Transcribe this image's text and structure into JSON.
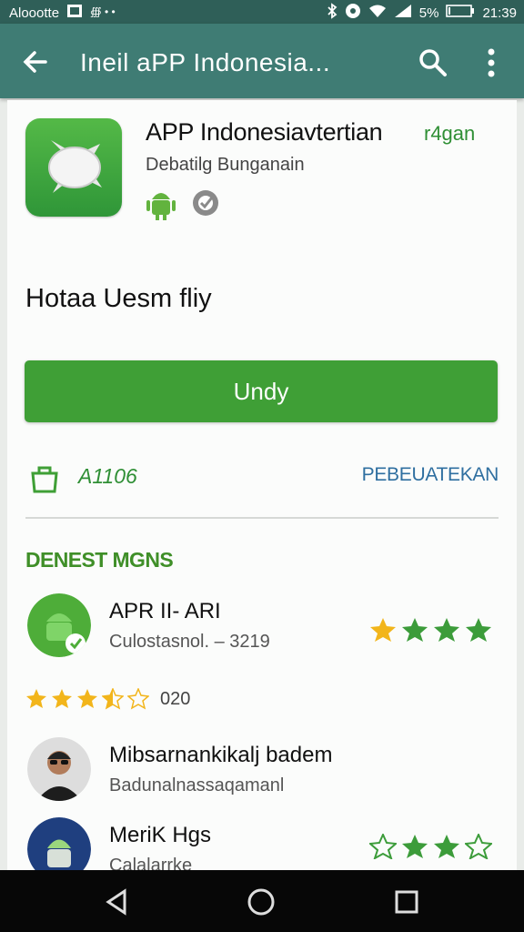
{
  "status_bar": {
    "carrier": "Aloootte",
    "battery_percent": "5%",
    "time": "21:39"
  },
  "app_bar": {
    "title": "Ineil aPP Indonesia..."
  },
  "app": {
    "name": "APP Indonesiavtertian",
    "tag": "r4gan",
    "developer": "Debatilg Bunganain",
    "headline": "Hotaa Uesm fliy",
    "install_label": "Undy",
    "size": "A1106",
    "details_label": "PEBEUATEKAN"
  },
  "reviews_section": {
    "title": "DENEST MGNS",
    "items": [
      {
        "name": "APR II- ARI",
        "subtitle": "Culostasnol. – 3219",
        "stars": [
          "full",
          "full",
          "full",
          "full"
        ]
      },
      {
        "name": "Mibsarnankikalj badem",
        "subtitle": "Badunalnassaqamanl"
      },
      {
        "name": "MeriK Hgs",
        "subtitle": "Calalarrke",
        "stars": [
          "outline",
          "full",
          "full",
          "outline"
        ]
      }
    ],
    "rating_line": {
      "stars": [
        "full",
        "full",
        "full",
        "half",
        "outline"
      ],
      "count": "020"
    }
  },
  "colors": {
    "status_bar": "#2f5f58",
    "app_bar": "#3f7c74",
    "accent_green": "#3f9f36",
    "link_blue": "#2f6fa0"
  }
}
